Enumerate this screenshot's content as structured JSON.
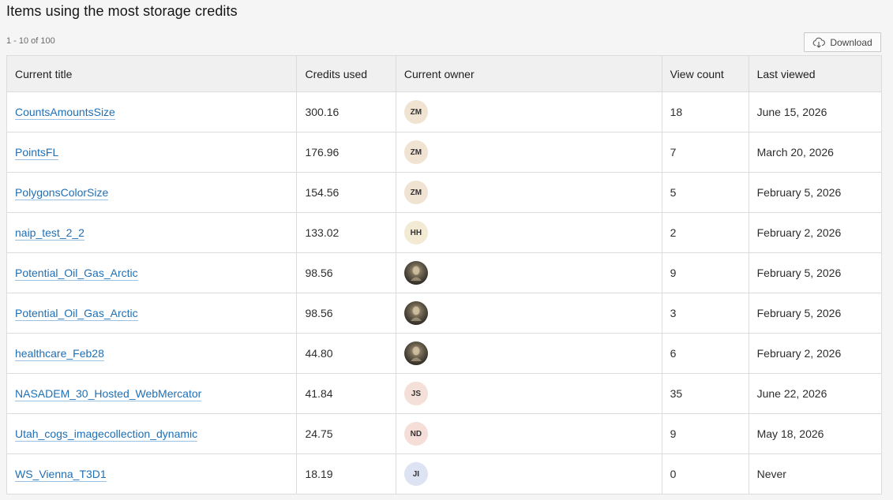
{
  "heading": "Items using the most storage credits",
  "range_label": "1 - 10 of 100",
  "download": {
    "label": "Download",
    "icon": "cloud-download-icon"
  },
  "columns": {
    "title": "Current title",
    "credits": "Credits used",
    "owner": "Current owner",
    "views": "View count",
    "last": "Last viewed"
  },
  "colors": {
    "link": "#1f6fb5",
    "header_bg": "#f0f0f0"
  },
  "rows": [
    {
      "title": "CountsAmountsSize",
      "credits": "300.16",
      "owner_initials": "ZM",
      "owner_type": "initials",
      "owner_color": "#f1e3d2",
      "views": "18",
      "last": "June 15, 2026"
    },
    {
      "title": "PointsFL",
      "credits": "176.96",
      "owner_initials": "ZM",
      "owner_type": "initials",
      "owner_color": "#f1e3d2",
      "views": "7",
      "last": "March 20, 2026"
    },
    {
      "title": "PolygonsColorSize",
      "credits": "154.56",
      "owner_initials": "ZM",
      "owner_type": "initials",
      "owner_color": "#f1e3d2",
      "views": "5",
      "last": "February 5, 2026"
    },
    {
      "title": "naip_test_2_2",
      "credits": "133.02",
      "owner_initials": "HH",
      "owner_type": "initials",
      "owner_color": "#f2ead3",
      "views": "2",
      "last": "February 2, 2026"
    },
    {
      "title": "Potential_Oil_Gas_Arctic",
      "credits": "98.56",
      "owner_initials": "",
      "owner_type": "photo",
      "owner_color": "#5b5244",
      "views": "9",
      "last": "February 5, 2026"
    },
    {
      "title": "Potential_Oil_Gas_Arctic",
      "credits": "98.56",
      "owner_initials": "",
      "owner_type": "photo",
      "owner_color": "#5b5244",
      "views": "3",
      "last": "February 5, 2026"
    },
    {
      "title": "healthcare_Feb28",
      "credits": "44.80",
      "owner_initials": "",
      "owner_type": "photo",
      "owner_color": "#5b5244",
      "views": "6",
      "last": "February 2, 2026"
    },
    {
      "title": "NASADEM_30_Hosted_WebMercator",
      "credits": "41.84",
      "owner_initials": "JS",
      "owner_type": "initials",
      "owner_color": "#f4e0d8",
      "views": "35",
      "last": "June 22, 2026"
    },
    {
      "title": "Utah_cogs_imagecollection_dynamic",
      "credits": "24.75",
      "owner_initials": "ND",
      "owner_type": "initials",
      "owner_color": "#f5ddd8",
      "views": "9",
      "last": "May 18, 2026"
    },
    {
      "title": "WS_Vienna_T3D1",
      "credits": "18.19",
      "owner_initials": "JI",
      "owner_type": "initials",
      "owner_color": "#dde3f3",
      "views": "0",
      "last": "Never"
    }
  ]
}
